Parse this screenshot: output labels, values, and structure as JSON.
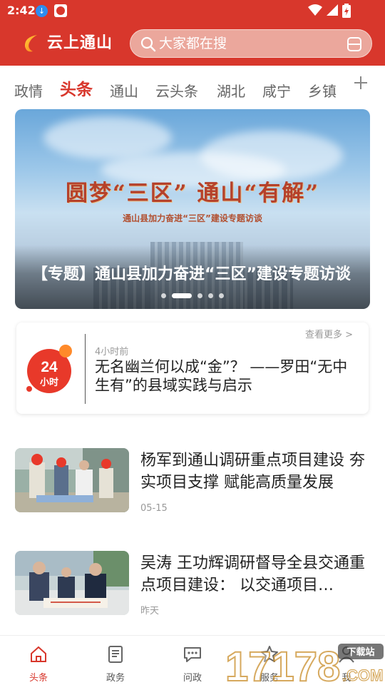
{
  "status_bar": {
    "time": "2:42",
    "download_icon": "download-icon",
    "app_icon": "app-notification-icon"
  },
  "header": {
    "logo_text": "云上通山",
    "search_placeholder": "大家都在搜",
    "brand_color": "#d8372c"
  },
  "tabs": [
    {
      "label": "政情",
      "active": false
    },
    {
      "label": "头条",
      "active": true
    },
    {
      "label": "通山",
      "active": false
    },
    {
      "label": "云头条",
      "active": false
    },
    {
      "label": "湖北",
      "active": false
    },
    {
      "label": "咸宁",
      "active": false
    },
    {
      "label": "乡镇",
      "active": false
    }
  ],
  "banner": {
    "headline": "圆梦“三区”  通山“有解”",
    "subline": "通山县加力奋进“三区”建设专题访谈",
    "title": "【专题】通山县加力奋进“三区”建设专题访谈",
    "slide_count": 5,
    "active_slide": 2
  },
  "card24": {
    "badge_top": "24",
    "badge_bottom": "小时",
    "more": "查看更多 >",
    "time": "4小时前",
    "text": "无名幽兰何以成“金”？ ——罗田“无中生有”的县域实践与启示"
  },
  "news": [
    {
      "title": "杨军到通山调研重点项目建设 夯实项目支撑 赋能高质量发展",
      "date": "05-15"
    },
    {
      "title": "吴涛 王功辉调研督导全县交通重点项目建设： 以交通项目…",
      "date": "昨天"
    }
  ],
  "bottom_nav": [
    {
      "label": "头条",
      "icon": "home-icon",
      "active": true
    },
    {
      "label": "政务",
      "icon": "document-icon",
      "active": false
    },
    {
      "label": "问政",
      "icon": "chat-icon",
      "active": false
    },
    {
      "label": "服务",
      "icon": "service-icon",
      "active": false
    },
    {
      "label": "我",
      "icon": "user-icon",
      "active": false
    }
  ],
  "watermark": {
    "text": "17178",
    "sub": "下载站",
    "suffix": ".COM"
  }
}
